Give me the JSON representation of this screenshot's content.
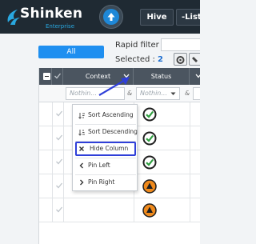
{
  "header": {
    "brand_name": "Shinken",
    "brand_sub": "Enterprise",
    "hive_label": "Hive",
    "lists_label": "-Lists"
  },
  "filters": {
    "all_label": "All",
    "rapid_filter_label": "Rapid filter :",
    "rapid_filter_value": "",
    "selected_label": "Selected :",
    "selected_count": "2"
  },
  "grid": {
    "columns": {
      "context": "Context",
      "status": "Status"
    },
    "filter_placeholders": {
      "context": "Nothin...",
      "status": "Nothin..."
    },
    "filter_operator": "&",
    "rows": [
      {
        "status": "ok"
      },
      {
        "status": "ok"
      },
      {
        "status": "ok"
      },
      {
        "status": "warning"
      },
      {
        "status": "warning"
      }
    ]
  },
  "column_menu": {
    "items": [
      {
        "label": "Sort Ascending",
        "icon": "sort-ascending-icon"
      },
      {
        "label": "Sort Descending",
        "icon": "sort-descending-icon"
      },
      {
        "label": "Hide Column",
        "icon": "close-icon",
        "highlighted": true
      },
      {
        "label": "Pin Left",
        "icon": "chevron-left-icon"
      },
      {
        "label": "Pin Right",
        "icon": "chevron-right-icon"
      }
    ]
  },
  "colors": {
    "header_bg": "#1f2a33",
    "accent_blue": "#1f8ff0",
    "status_ok": "#2e9e3f",
    "status_warning": "#f08a1c",
    "highlight_border": "#2f3fd8"
  }
}
